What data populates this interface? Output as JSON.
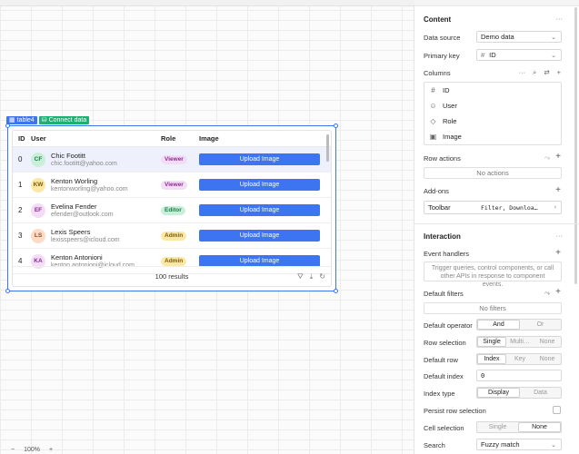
{
  "canvas": {
    "component_tag": "table4",
    "connect_tag": "Connect data",
    "zoom": "100%",
    "zoom_minus": "−",
    "zoom_plus": "+"
  },
  "table": {
    "headers": {
      "id": "ID",
      "user": "User",
      "role": "Role",
      "image": "Image"
    },
    "rows": [
      {
        "id": "0",
        "initials": "CF",
        "name": "Chic Footitt",
        "email": "chic.footitt@yahoo.com",
        "role": "Viewer",
        "button": "Upload Image",
        "avatar_bg": "#c8f0d8",
        "avatar_fg": "#1f7a49",
        "role_bg": "#f3dcf5",
        "role_fg": "#8a2d92"
      },
      {
        "id": "1",
        "initials": "KW",
        "name": "Kenton Worling",
        "email": "kentonworling@yahoo.com",
        "role": "Viewer",
        "button": "Upload Image",
        "avatar_bg": "#fbe8a6",
        "avatar_fg": "#7a5c0a",
        "role_bg": "#f3dcf5",
        "role_fg": "#8a2d92"
      },
      {
        "id": "2",
        "initials": "EF",
        "name": "Evelina Fender",
        "email": "efender@outlook.com",
        "role": "Editor",
        "button": "Upload Image",
        "avatar_bg": "#f3dcf5",
        "avatar_fg": "#8a2d92",
        "role_bg": "#c8f0d8",
        "role_fg": "#1f7a49"
      },
      {
        "id": "3",
        "initials": "LS",
        "name": "Lexis Speers",
        "email": "lexisspeers@icloud.com",
        "role": "Admin",
        "button": "Upload Image",
        "avatar_bg": "#fcdcc7",
        "avatar_fg": "#9a4a1a",
        "role_bg": "#fbe8a6",
        "role_fg": "#7a5c0a"
      },
      {
        "id": "4",
        "initials": "KA",
        "name": "Kenton Antonioni",
        "email": "kenton.antonioni@icloud.com",
        "role": "Admin",
        "button": "Upload Image",
        "avatar_bg": "#f3dcf5",
        "avatar_fg": "#8a2d92",
        "role_bg": "#fbe8a6",
        "role_fg": "#7a5c0a"
      }
    ],
    "results": "100 results"
  },
  "inspector": {
    "content_title": "Content",
    "data_source_label": "Data source",
    "data_source_value": "Demo data",
    "primary_key_label": "Primary key",
    "primary_key_value": "ID",
    "columns_label": "Columns",
    "columns": [
      {
        "icon": "#",
        "label": "ID"
      },
      {
        "icon": "☺",
        "label": "User"
      },
      {
        "icon": "◇",
        "label": "Role"
      },
      {
        "icon": "▣",
        "label": "Image"
      }
    ],
    "row_actions_label": "Row actions",
    "no_actions": "No actions",
    "addons_label": "Add-ons",
    "toolbar_label": "Toolbar",
    "toolbar_value": "Filter, Downloa…",
    "interaction_title": "Interaction",
    "event_handlers_label": "Event handlers",
    "event_handlers_hint": "Trigger queries, control components, or call other APIs in response to component events.",
    "default_filters_label": "Default filters",
    "no_filters": "No filters",
    "default_operator_label": "Default operator",
    "operator_options": [
      "And",
      "Or"
    ],
    "row_selection_label": "Row selection",
    "row_selection_options": [
      "Single",
      "Multi…",
      "None"
    ],
    "default_row_label": "Default row",
    "default_row_options": [
      "Index",
      "Key",
      "None"
    ],
    "default_index_label": "Default index",
    "default_index_value": "0",
    "index_type_label": "Index type",
    "index_type_options": [
      "Display",
      "Data"
    ],
    "persist_label": "Persist row selection",
    "cell_selection_label": "Cell selection",
    "cell_selection_options": [
      "Single",
      "None"
    ],
    "search_label": "Search",
    "search_value": "Fuzzy match"
  }
}
